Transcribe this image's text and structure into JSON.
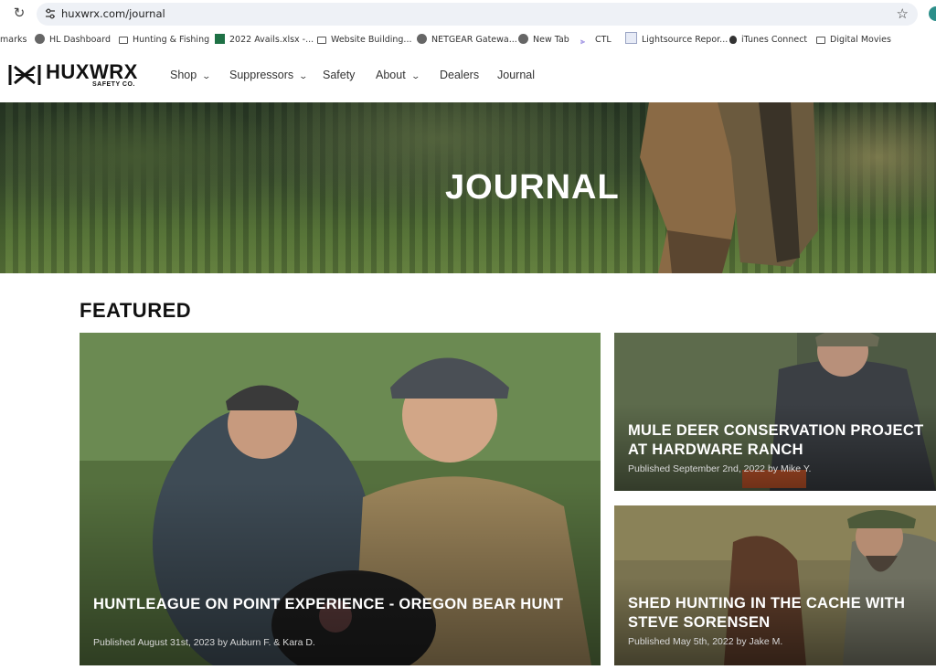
{
  "browser": {
    "url": "huxwrx.com/journal",
    "bookmarks": [
      {
        "label": "marks",
        "icon": "none"
      },
      {
        "label": "HL Dashboard",
        "icon": "globe-icon"
      },
      {
        "label": "Hunting & Fishing",
        "icon": "folder-icon"
      },
      {
        "label": "2022 Avails.xlsx -...",
        "icon": "excel-icon"
      },
      {
        "label": "Website Building...",
        "icon": "folder-icon"
      },
      {
        "label": "NETGEAR Gatewa...",
        "icon": "globe-icon"
      },
      {
        "label": "New Tab",
        "icon": "globe-icon"
      },
      {
        "label": "CTL",
        "icon": "ctl-icon"
      },
      {
        "label": "Lightsource Repor...",
        "icon": "document-icon"
      },
      {
        "label": "iTunes Connect",
        "icon": "apple-icon"
      },
      {
        "label": "Digital Movies",
        "icon": "folder-icon"
      }
    ]
  },
  "site": {
    "logo_text": "HUXWRX",
    "logo_subtext": "SAFETY CO.",
    "nav": [
      {
        "label": "Shop",
        "dropdown": true
      },
      {
        "label": "Suppressors",
        "dropdown": true
      },
      {
        "label": "Safety",
        "dropdown": false
      },
      {
        "label": "About",
        "dropdown": true
      },
      {
        "label": "Dealers",
        "dropdown": false
      },
      {
        "label": "Journal",
        "dropdown": false
      }
    ]
  },
  "hero": {
    "title": "JOURNAL"
  },
  "featured": {
    "heading": "FEATURED",
    "articles": [
      {
        "title": "HUNTLEAGUE ON POINT EXPERIENCE - OREGON BEAR HUNT",
        "meta": "Published August 31st, 2023 by Auburn F. & Kara D."
      },
      {
        "title": "MULE DEER CONSERVATION PROJECT AT HARDWARE RANCH",
        "meta": "Published September 2nd, 2022 by Mike Y."
      },
      {
        "title": "SHED HUNTING IN THE CACHE WITH STEVE SORENSEN",
        "meta": "Published May 5th, 2022 by Jake M."
      }
    ]
  }
}
